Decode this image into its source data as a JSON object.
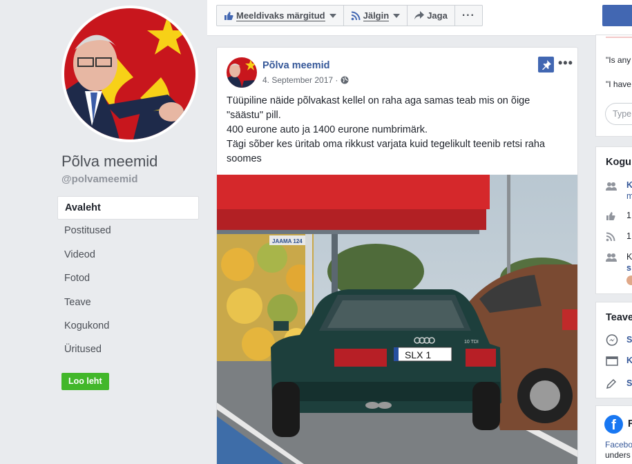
{
  "sidebar": {
    "page_name": "Põlva meemid",
    "handle": "@polvameemid",
    "nav": [
      {
        "label": "Avaleht",
        "active": true
      },
      {
        "label": "Postitused"
      },
      {
        "label": "Videod"
      },
      {
        "label": "Fotod"
      },
      {
        "label": "Teave"
      },
      {
        "label": "Kogukond"
      },
      {
        "label": "Üritused"
      }
    ],
    "create_page": "Loo leht"
  },
  "toolbar": {
    "liked": "Meeldivaks märgitud",
    "following": "Jälgin",
    "share": "Jaga",
    "more": "···"
  },
  "post": {
    "author": "Põlva meemid",
    "date": "4. September 2017 ·",
    "more": "•••",
    "lines": [
      "Tüüpiline näide põlvakast kellel on raha aga samas teab mis on õige",
      "\"säästu\" pill.",
      "400 eurone auto ja 1400 eurone numbrimärk.",
      "Tägi sõber kes üritab oma rikkust varjata kuid tegelikult teenib retsi raha",
      "soomes"
    ],
    "photo": {
      "station_sign": "JAAMA 124",
      "plate": "SLX   1",
      "model_badge": "10 TDI"
    }
  },
  "right": {
    "q1": "\"Is any",
    "q2": "\"I have",
    "type_placeholder": "Type",
    "community_title": "Kogu",
    "community_rows": [
      {
        "icon": "people-icon",
        "line1": "K",
        "line2": "m"
      },
      {
        "icon": "thumbs-up-icon",
        "line1": "1"
      },
      {
        "icon": "rss-icon",
        "line1": "1"
      },
      {
        "icon": "people-icon",
        "line1": "K",
        "line2": "s"
      }
    ],
    "about_title": "Teave",
    "about_rows": [
      {
        "icon": "messenger-icon",
        "text": "S"
      },
      {
        "icon": "card-icon",
        "text": "K"
      },
      {
        "icon": "pencil-icon",
        "text": "S"
      }
    ],
    "fb_letter": "f",
    "fb_title": "F",
    "fb_line1": "Facebo",
    "fb_line2": "unders",
    "colors": {
      "brand": "#4267b2",
      "link": "#365899",
      "green": "#42b72a"
    }
  }
}
